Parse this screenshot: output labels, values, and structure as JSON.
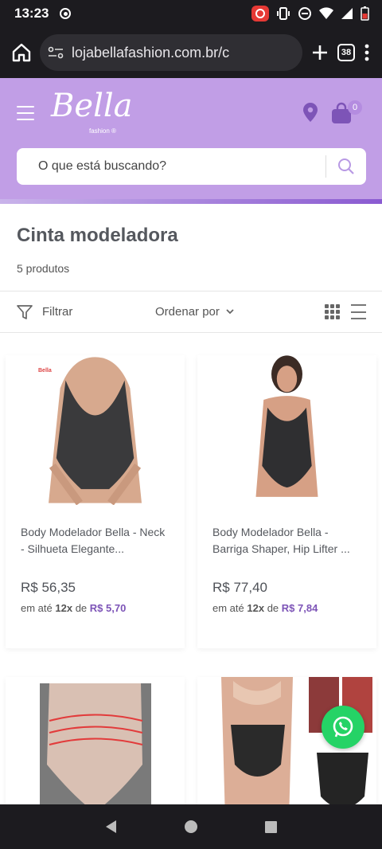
{
  "status_bar": {
    "time": "13:23"
  },
  "browser": {
    "url": "lojabellafashion.com.br/c",
    "tab_count": "38"
  },
  "header": {
    "logo": "Bella",
    "logo_sub": "fashion ®",
    "cart_count": "0",
    "search_placeholder": "O que está buscando?"
  },
  "category": {
    "title": "Cinta modeladora",
    "count": "5 produtos"
  },
  "toolbar": {
    "filter_label": "Filtrar",
    "sort_label": "Ordenar por"
  },
  "products": [
    {
      "name": "Body Modelador Bella - Neck - Silhueta Elegante...",
      "price": "R$ 56,35",
      "installment_prefix": "em até",
      "installment_times": "12x",
      "installment_of": "de",
      "installment_value": "R$ 5,70",
      "brand_mark": "Bella"
    },
    {
      "name": "Body Modelador Bella - Barriga Shaper, Hip Lifter ...",
      "price": "R$ 77,40",
      "installment_prefix": "em até",
      "installment_times": "12x",
      "installment_of": "de",
      "installment_value": "R$ 7,84"
    }
  ],
  "colors": {
    "header_bg": "#c19ee6",
    "accent": "#7d54b7",
    "whatsapp": "#25d366"
  }
}
